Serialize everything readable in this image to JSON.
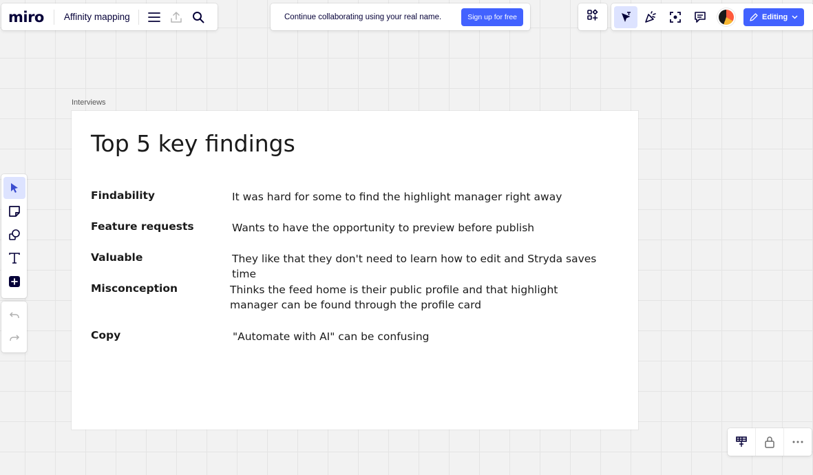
{
  "header": {
    "logo": "miro",
    "board_title": "Affinity mapping",
    "menu_icon": "hamburger-icon",
    "export_icon": "upload-icon",
    "search_icon": "search-icon"
  },
  "banner": {
    "text": "Continue collaborating using your real name.",
    "signup_label": "Sign up for free"
  },
  "top_right": {
    "apps_icon": "apps-icon",
    "icons": [
      "cursor-follow-icon",
      "reactions-icon",
      "focus-icon",
      "comments-icon"
    ],
    "editing_label": "Editing"
  },
  "left_toolbar": {
    "tools": [
      "select-icon",
      "sticky-note-icon",
      "shapes-icon",
      "text-icon",
      "add-icon"
    ],
    "undo": "undo-icon",
    "redo": "redo-icon"
  },
  "bottom_right": {
    "icons": [
      "board-format-icon",
      "lock-icon",
      "more-icon"
    ]
  },
  "frame": {
    "label": "Interviews",
    "heading": "Top 5 key findings",
    "findings": [
      {
        "label": "Findability",
        "text": "It was hard for some to find the highlight manager right away"
      },
      {
        "label": "Feature requests",
        "text": "Wants to have the opportunity to preview before publish"
      },
      {
        "label": "Valuable",
        "text": "They like that they don't need to learn how to edit and Stryda saves time"
      },
      {
        "label": "Misconception",
        "text": "Thinks the feed home is their public profile and that highlight manager can be found through the profile card"
      },
      {
        "label": "Copy",
        "text": "\"Automate with AI\" can be confusing"
      }
    ]
  },
  "colors": {
    "accent": "#4262ff",
    "logo": "#050038",
    "canvas": "#f2f2f2",
    "active_tool_bg": "#dde3ff"
  }
}
